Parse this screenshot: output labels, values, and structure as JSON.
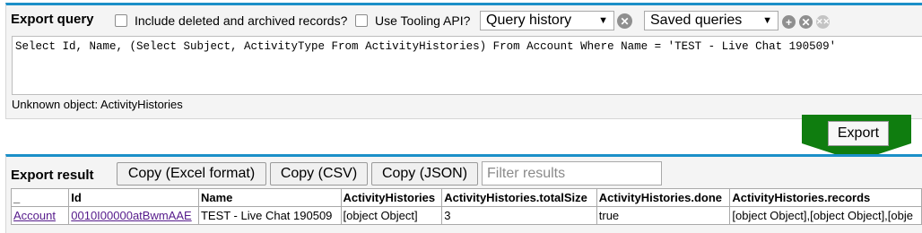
{
  "query_panel": {
    "title": "Export query",
    "include_deleted_label": "Include deleted and archived records?",
    "tooling_api_label": "Use Tooling API?",
    "history_select": "Query history",
    "saved_select": "Saved queries",
    "query_text": "Select Id, Name, (Select Subject, ActivityType From ActivityHistories) From Account Where Name = 'TEST - Live Chat 190509'",
    "status": "Unknown object: ActivityHistories"
  },
  "export_button": "Export",
  "result_panel": {
    "title": "Export result",
    "copy_excel": "Copy (Excel format)",
    "copy_csv": "Copy (CSV)",
    "copy_json": "Copy (JSON)",
    "filter_placeholder": "Filter results"
  },
  "table": {
    "headers": [
      "_",
      "Id",
      "Name",
      "ActivityHistories",
      "ActivityHistories.totalSize",
      "ActivityHistories.done",
      "ActivityHistories.records"
    ],
    "rows": [
      [
        "Account",
        "0010I00000atBwmAAE",
        "TEST - Live Chat 190509",
        "[object Object]",
        "3",
        "true",
        "[object Object],[object Object],[obje"
      ]
    ]
  },
  "colors": {
    "accent": "#1b8fc8",
    "export_arrow": "#0f7d0f"
  }
}
